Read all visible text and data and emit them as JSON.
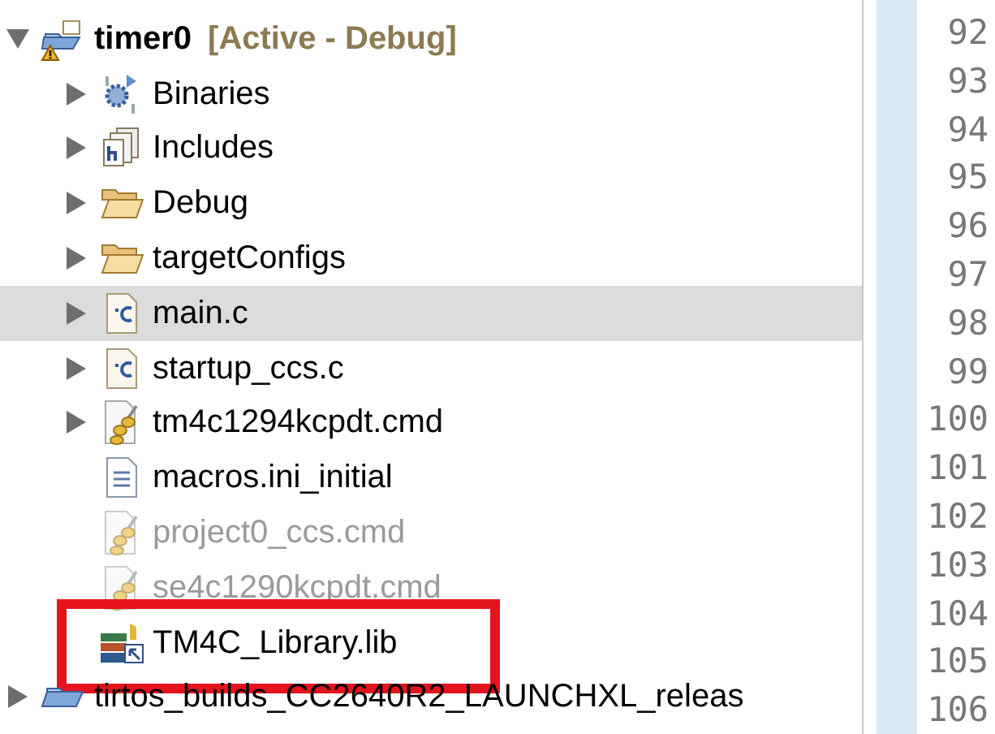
{
  "project_tree": [
    {
      "label": "timer0",
      "kind": "project",
      "expanded": true,
      "selected": false,
      "dimmed": false,
      "annotated": false,
      "suffix": "[Active - Debug]",
      "children": [
        {
          "label": "Binaries",
          "kind": "binaries",
          "expanded": false,
          "selected": false,
          "dimmed": false,
          "annotated": false
        },
        {
          "label": "Includes",
          "kind": "includes",
          "expanded": false,
          "selected": false,
          "dimmed": false,
          "annotated": false
        },
        {
          "label": "Debug",
          "kind": "folder",
          "expanded": false,
          "selected": false,
          "dimmed": false,
          "annotated": false
        },
        {
          "label": "targetConfigs",
          "kind": "folder",
          "expanded": false,
          "selected": false,
          "dimmed": false,
          "annotated": false
        },
        {
          "label": "main.c",
          "kind": "c_file",
          "expanded": false,
          "selected": true,
          "dimmed": false,
          "annotated": false
        },
        {
          "label": "startup_ccs.c",
          "kind": "c_file",
          "expanded": false,
          "selected": false,
          "dimmed": false,
          "annotated": false
        },
        {
          "label": "tm4c1294kcpdt.cmd",
          "kind": "cmd_file",
          "expanded": false,
          "selected": false,
          "dimmed": false,
          "annotated": false
        },
        {
          "label": "macros.ini_initial",
          "kind": "text_file",
          "selected": false,
          "dimmed": false,
          "annotated": false
        },
        {
          "label": "project0_ccs.cmd",
          "kind": "cmd_file",
          "selected": false,
          "dimmed": true,
          "annotated": false
        },
        {
          "label": "se4c1290kcpdt.cmd",
          "kind": "cmd_file",
          "selected": false,
          "dimmed": true,
          "annotated": false
        },
        {
          "label": "TM4C_Library.lib",
          "kind": "library",
          "selected": false,
          "dimmed": false,
          "annotated": true
        }
      ]
    },
    {
      "label": "tirtos_builds_CC2640R2_LAUNCHXL_releas",
      "kind": "project_plain",
      "expanded": false,
      "selected": false,
      "dimmed": false,
      "annotated": false
    }
  ],
  "line_numbers": [
    "92",
    "93",
    "94",
    "95",
    "96",
    "97",
    "98",
    "99",
    "100",
    "101",
    "102",
    "103",
    "104",
    "105",
    "106"
  ]
}
